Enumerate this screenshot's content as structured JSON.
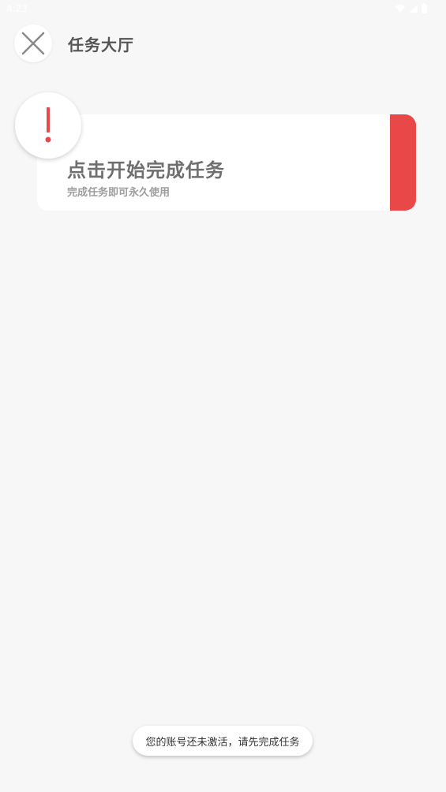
{
  "status_bar": {
    "time": "4:23",
    "icons": [
      "wifi-icon",
      "signal-icon",
      "battery-icon"
    ]
  },
  "header": {
    "close_icon": "close-icon",
    "title": "任务大厅"
  },
  "task_card": {
    "badge_icon": "exclamation-icon",
    "title": "点击开始完成任务",
    "subtitle": "完成任务即可永久使用"
  },
  "toast": {
    "message": "您的账号还未激活，请先完成任务"
  },
  "colors": {
    "background": "#f7f7f7",
    "accent": "#e94848",
    "title_text": "#555555"
  }
}
